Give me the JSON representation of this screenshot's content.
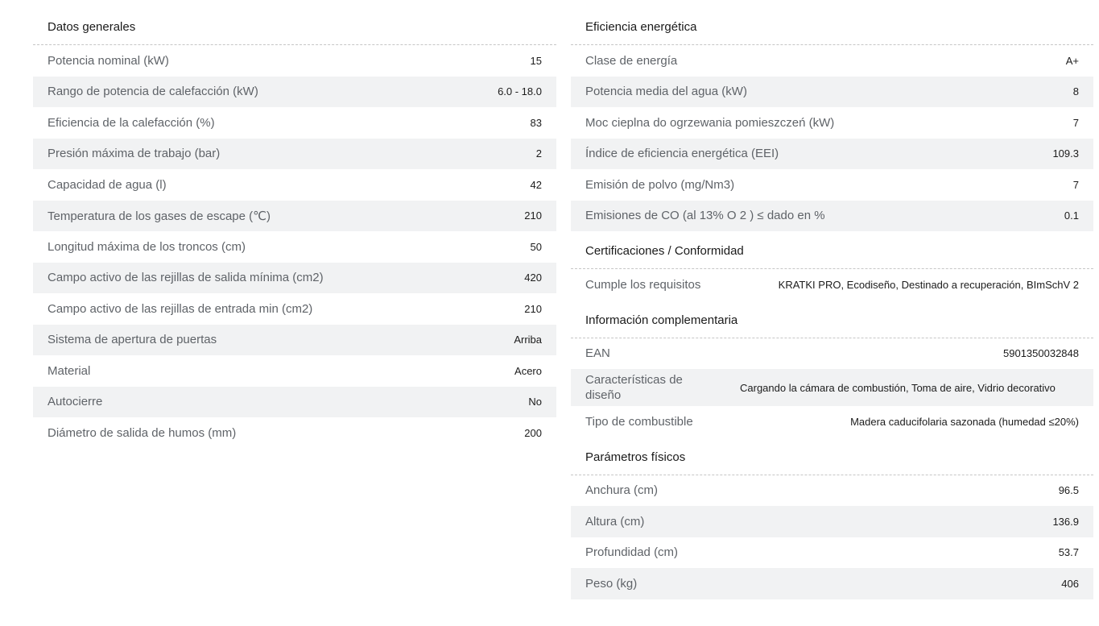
{
  "left": {
    "title": "Datos generales",
    "rows": [
      {
        "label": "Potencia nominal (kW)",
        "value": "15"
      },
      {
        "label": "Rango de potencia de calefacción (kW)",
        "value": "6.0 - 18.0"
      },
      {
        "label": "Eficiencia de la calefacción (%)",
        "value": "83"
      },
      {
        "label": "Presión máxima de trabajo (bar)",
        "value": "2"
      },
      {
        "label": "Capacidad de agua (l)",
        "value": "42"
      },
      {
        "label": "Temperatura de los gases de escape (℃)",
        "value": "210"
      },
      {
        "label": "Longitud máxima de los troncos (cm)",
        "value": "50"
      },
      {
        "label": "Campo activo de las rejillas de salida mínima (cm2)",
        "value": "420"
      },
      {
        "label": "Campo activo de las rejillas de entrada min (cm2)",
        "value": "210"
      },
      {
        "label": "Sistema de apertura de puertas",
        "value": "Arriba"
      },
      {
        "label": "Material",
        "value": "Acero"
      },
      {
        "label": "Autocierre",
        "value": "No"
      },
      {
        "label": "Diámetro de salida de humos (mm)",
        "value": "200"
      }
    ]
  },
  "energy": {
    "title": "Eficiencia energética",
    "rows": [
      {
        "label": "Clase de energía",
        "value": "A+"
      },
      {
        "label": "Potencia media del agua (kW)",
        "value": "8"
      },
      {
        "label": "Moc cieplna do ogrzewania pomieszczeń (kW)",
        "value": "7"
      },
      {
        "label": "Índice de eficiencia energética (EEI)",
        "value": "109.3"
      },
      {
        "label": "Emisión de polvo (mg/Nm3)",
        "value": "7"
      },
      {
        "label": "Emisiones de CO (al 13% O 2 ) ≤ dado en %",
        "value": "0.1"
      }
    ]
  },
  "cert": {
    "title": "Certificaciones / Conformidad",
    "rows": [
      {
        "label": "Cumple los requisitos",
        "value": "KRATKI PRO, Ecodiseño, Destinado a recuperación, BImSchV 2"
      }
    ]
  },
  "info": {
    "title": "Información complementaria",
    "rows": [
      {
        "label": "EAN",
        "value": "5901350032848"
      },
      {
        "label": "Características de diseño",
        "value": "Cargando la cámara de combustión, Toma de aire, Vidrio decorativo"
      },
      {
        "label": "Tipo de combustible",
        "value": "Madera caducifolaria sazonada (humedad ≤20%)"
      }
    ]
  },
  "phys": {
    "title": "Parámetros físicos",
    "rows": [
      {
        "label": "Anchura (cm)",
        "value": "96.5"
      },
      {
        "label": "Altura (cm)",
        "value": "136.9"
      },
      {
        "label": "Profundidad (cm)",
        "value": "53.7"
      },
      {
        "label": "Peso (kg)",
        "value": "406"
      }
    ]
  }
}
